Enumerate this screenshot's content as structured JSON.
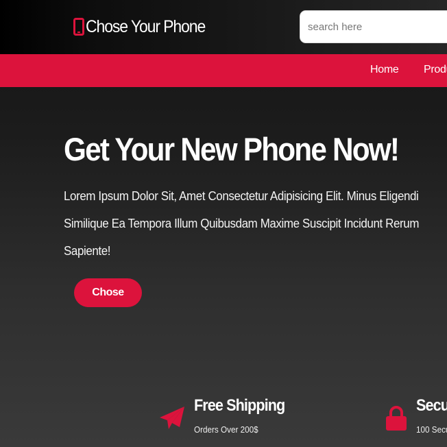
{
  "header": {
    "brand_icon": "phone-icon",
    "brand_title": "Chose Your Phone",
    "search_placeholder": "search here"
  },
  "nav": {
    "items": [
      {
        "label": "Home"
      },
      {
        "label": "Produ"
      }
    ]
  },
  "hero": {
    "title": "Get Your New Phone Now!",
    "text_lines": [
      "Lorem Ipsum Dolor Sit, Amet Consectetur Adipisicing Elit. Minus Eligendi",
      "Similique Ea Tempora Illum Quibusdam Maxime Suscipit Incidunt Rerum",
      "Sapiente!"
    ],
    "cta_label": "Chose"
  },
  "features": [
    {
      "icon": "paper-plane-icon",
      "title": "Free Shipping",
      "subtitle": "Orders Over 200$"
    },
    {
      "icon": "lock-icon",
      "title": "Secu",
      "subtitle": "100 Secu"
    }
  ],
  "colors": {
    "accent": "#dc133c",
    "background_dark": "#141414",
    "background_light": "#3a3a3a"
  }
}
